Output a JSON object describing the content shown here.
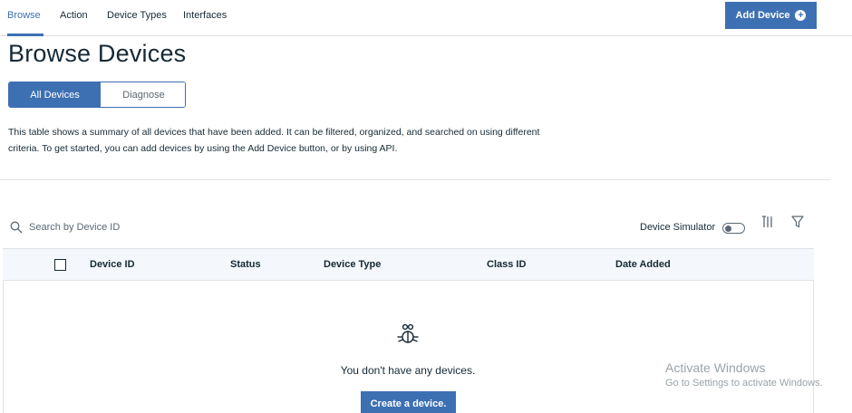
{
  "nav": {
    "tabs": [
      {
        "label": "Browse",
        "active": true
      },
      {
        "label": "Action",
        "active": false
      },
      {
        "label": "Device Types",
        "active": false
      },
      {
        "label": "Interfaces",
        "active": false
      }
    ],
    "add_device_label": "Add Device",
    "add_device_icon": "plus-circle-icon"
  },
  "page": {
    "title": "Browse Devices",
    "segments": [
      "All Devices",
      "Diagnose"
    ],
    "description": "This table shows a summary of all devices that have been added. It can be filtered, organized, and searched on using different criteria. To get started, you can add devices by using the Add Device button, or by using API."
  },
  "toolbar": {
    "search_placeholder": "Search by Device ID",
    "simulator_label": "Device Simulator",
    "simulator_on": false,
    "icons": [
      "search-icon",
      "columns-icon",
      "filter-icon"
    ]
  },
  "table": {
    "columns": [
      "Device ID",
      "Status",
      "Device Type",
      "Class ID",
      "Date Added"
    ],
    "empty_icon": "devices-icon",
    "empty_text": "You don't have any devices.",
    "create_label": "Create a device."
  },
  "watermark": {
    "title": "Activate Windows",
    "subtitle": "Go to Settings to activate Windows."
  },
  "colors": {
    "accent": "#3d70b2",
    "text": "#152935",
    "header_bg": "#f4f7fb"
  }
}
